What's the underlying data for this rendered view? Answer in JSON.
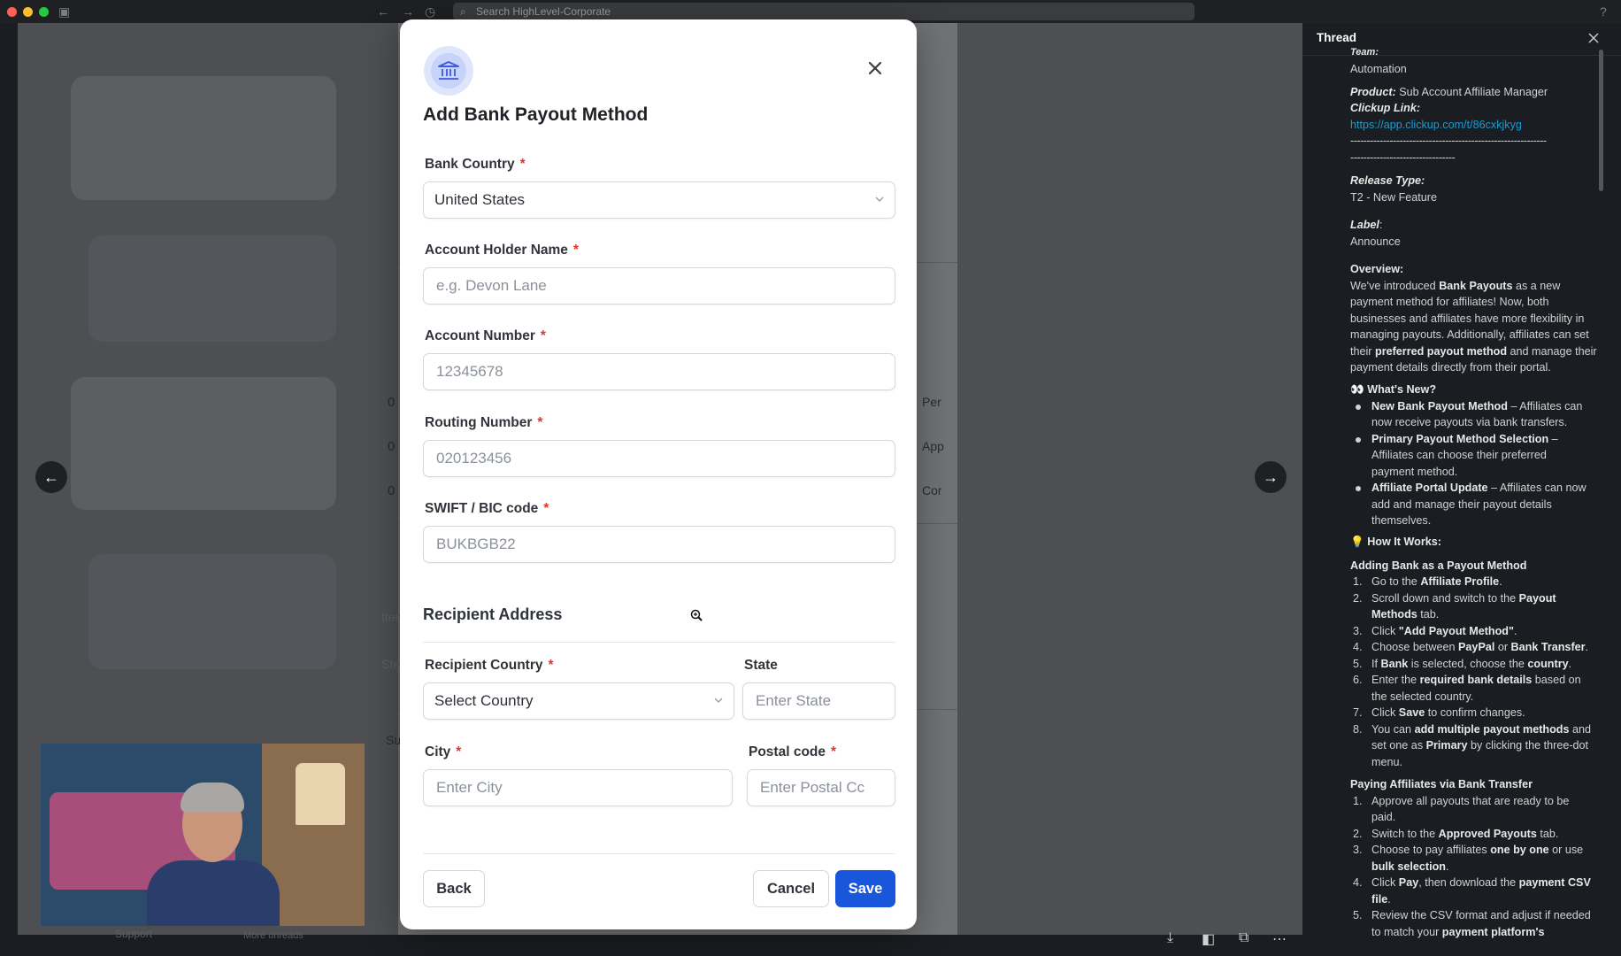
{
  "topbar": {
    "search_placeholder": "Search HighLevel-Corporate",
    "colors": {
      "close": "#ff5f57",
      "minimize": "#febc2e",
      "zoom": "#28c840"
    }
  },
  "viewer": {
    "bg_numbers": [
      "0",
      "0",
      "0"
    ],
    "bg_labels": [
      "Per",
      "App",
      "Cor",
      "Su",
      "Item",
      "Ste"
    ],
    "bottom_labels": [
      "Support",
      "More unreads"
    ]
  },
  "modal": {
    "title": "Add Bank Payout Method",
    "fields": {
      "bank_country": {
        "label": "Bank Country",
        "value": "United States"
      },
      "account_holder": {
        "label": "Account Holder Name",
        "placeholder": "e.g. Devon Lane"
      },
      "account_number": {
        "label": "Account Number",
        "placeholder": "12345678"
      },
      "routing_number": {
        "label": "Routing Number",
        "placeholder": "020123456"
      },
      "swift": {
        "label": "SWIFT / BIC code",
        "placeholder": "BUKBGB22"
      },
      "recipient_country": {
        "label": "Recipient Country",
        "value": "Select Country"
      },
      "state": {
        "label": "State",
        "placeholder": "Enter State"
      },
      "city": {
        "label": "City",
        "placeholder": "Enter City"
      },
      "postal": {
        "label": "Postal code",
        "placeholder": "Enter Postal Cc"
      }
    },
    "required_mark": "*",
    "section_title": "Recipient Address",
    "buttons": {
      "back": "Back",
      "cancel": "Cancel",
      "save": "Save"
    },
    "colors": {
      "primary": "#1a56db",
      "required": "#e0362c"
    }
  },
  "thread": {
    "title": "Thread",
    "team_label": "Team:",
    "team_value": "Automation",
    "product_label": "Product:",
    "product_value": "Sub Account Affiliate Manager",
    "clickup_label": "Clickup Link:",
    "clickup_url": "https://app.clickup.com/t/86cxkjkyg",
    "separator_1": "------------------------------------------------------------",
    "separator_2": "--------------------------------",
    "release_label": "Release Type:",
    "release_value": "T2 - New Feature",
    "label_label": "Label",
    "label_colon": ":",
    "label_value": "Announce",
    "overview_label": "Overview:",
    "overview": {
      "l1_a": "We've introduced ",
      "l1_b": "Bank Payouts",
      "l1_c": " as a new",
      "l2": "payment method for affiliates! Now, both",
      "l3": "businesses and affiliates have more flexibility in",
      "l4": "managing payouts. Additionally, affiliates can set",
      "l5_a": "their ",
      "l5_b": "preferred payout method",
      "l5_c": " and manage their",
      "l6": "payment details directly from their portal."
    },
    "whats_new_emoji": "👀",
    "whats_new_label": "What's New?",
    "whats_new": [
      {
        "bold": "New Bank Payout Method",
        "rest": " – Affiliates can",
        "cont": [
          "now receive payouts via bank transfers."
        ]
      },
      {
        "bold": "Primary Payout Method Selection",
        "rest": " –",
        "cont": [
          "Affiliates can choose their preferred",
          "payment method."
        ]
      },
      {
        "bold": "Affiliate Portal Update",
        "rest": " – Affiliates can now",
        "cont": [
          "add and manage their payout details",
          "themselves."
        ]
      }
    ],
    "how_emoji": "💡",
    "how_label": "How It Works:",
    "adding_title": "Adding Bank as a Payout Method",
    "adding_steps": {
      "s1_a": "Go to the ",
      "s1_b": "Affiliate Profile",
      "s1_c": ".",
      "s2_a": "Scroll down and switch to the ",
      "s2_b": "Payout",
      "s2_c": "Methods",
      "s2_d": " tab.",
      "s3_a": "Click ",
      "s3_b": "\"Add Payout Method\"",
      "s3_c": ".",
      "s4_a": "Choose between ",
      "s4_b": "PayPal",
      "s4_c": " or ",
      "s4_d": "Bank Transfer",
      "s4_e": ".",
      "s5_a": "If ",
      "s5_b": "Bank",
      "s5_c": " is selected, choose the ",
      "s5_d": "country",
      "s5_e": ".",
      "s6_a": "Enter the ",
      "s6_b": "required bank details",
      "s6_c": " based on",
      "s6_d": "the selected country.",
      "s7_a": "Click ",
      "s7_b": "Save",
      "s7_c": " to confirm changes.",
      "s8_a": "You can ",
      "s8_b": "add multiple payout methods",
      "s8_c": " and",
      "s8_d": "set one as ",
      "s8_e": "Primary",
      "s8_f": " by clicking the three-dot",
      "s8_g": "menu."
    },
    "paying_title": "Paying Affiliates via Bank Transfer",
    "paying_steps": {
      "p1_a": "Approve all payouts that are ready to be",
      "p1_b": "paid.",
      "p2_a": "Switch to the ",
      "p2_b": "Approved Payouts",
      "p2_c": " tab.",
      "p3_a": "Choose to pay affiliates ",
      "p3_b": "one by one",
      "p3_c": " or use",
      "p3_d": "bulk selection",
      "p3_e": ".",
      "p4_a": "Click ",
      "p4_b": "Pay",
      "p4_c": ", then download the ",
      "p4_d": "payment CSV",
      "p4_e": "file",
      "p4_f": ".",
      "p5_a": "Review the CSV format and adjust if needed",
      "p5_b": "to match your ",
      "p5_c": "payment platform's"
    },
    "numbers": [
      "1.",
      "2.",
      "3.",
      "4.",
      "5.",
      "6.",
      "7.",
      "8."
    ]
  }
}
